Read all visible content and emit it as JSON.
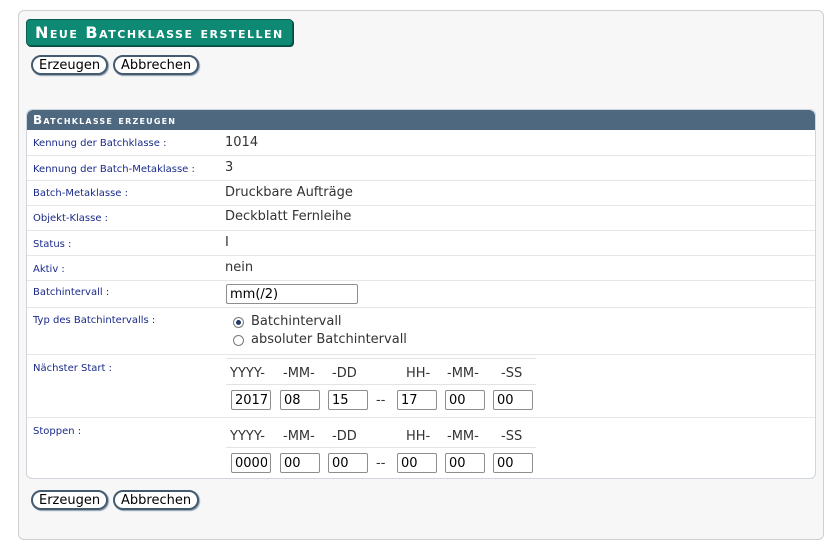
{
  "page": {
    "title": "Neue Batchklasse erstellen"
  },
  "buttons": {
    "create_label": "Erzeugen",
    "cancel_label": "Abbrechen"
  },
  "panel": {
    "header": "Batchklasse erzeugen"
  },
  "fields": {
    "kennung_batchklasse": {
      "label": "Kennung der Batchklasse :",
      "value": "1014"
    },
    "kennung_metaklasse": {
      "label": "Kennung der Batch-Metaklasse :",
      "value": "3"
    },
    "batch_metaklasse": {
      "label": "Batch-Metaklasse :",
      "value": "Druckbare Aufträge"
    },
    "objekt_klasse": {
      "label": "Objekt-Klasse :",
      "value": "Deckblatt Fernleihe"
    },
    "status": {
      "label": "Status :",
      "value": "I"
    },
    "aktiv": {
      "label": "Aktiv :",
      "value": "nein"
    },
    "batchintervall": {
      "label": "Batchintervall :",
      "value": "mm(/2)"
    },
    "typ_intervall": {
      "label": "Typ des Batchintervalls :",
      "options": [
        "Batchintervall",
        "absoluter Batchintervall"
      ],
      "selected": "Batchintervall"
    },
    "naechster_start": {
      "label": "Nächster Start :",
      "headers": [
        "YYYY-",
        "-MM-",
        "-DD",
        "HH-",
        "-MM-",
        "-SS"
      ],
      "separator": "--",
      "values": [
        "2017",
        "08",
        "15",
        "17",
        "00",
        "00"
      ]
    },
    "stoppen": {
      "label": "Stoppen :",
      "headers": [
        "YYYY-",
        "-MM-",
        "-DD",
        "HH-",
        "-MM-",
        "-SS"
      ],
      "separator": "--",
      "values": [
        "0000",
        "00",
        "00",
        "00",
        "00",
        "00"
      ]
    }
  },
  "colors": {
    "title_bg": "#0e8a74",
    "panel_header_bg": "#4e6880",
    "label_text": "#1a2a8a"
  }
}
